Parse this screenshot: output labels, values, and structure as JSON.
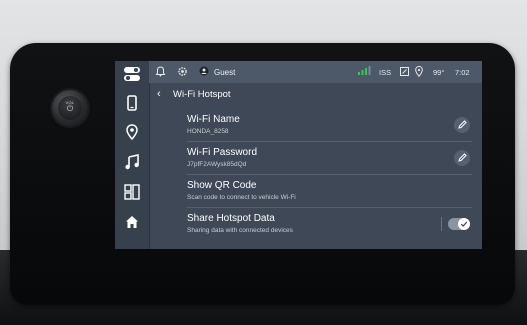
{
  "knob": {
    "label": "VOL",
    "icon": "power-icon"
  },
  "sidebar": {
    "items": [
      {
        "name": "toggles-icon"
      },
      {
        "name": "phone-icon"
      },
      {
        "name": "navigation-pin-icon"
      },
      {
        "name": "music-note-icon"
      },
      {
        "name": "apps-grid-icon"
      },
      {
        "name": "home-icon"
      }
    ]
  },
  "status": {
    "profile": "Guest",
    "network": "ISS",
    "temperature": "99°",
    "time": "7:02"
  },
  "header": {
    "back_label": "‹",
    "title": "Wi-Fi Hotspot"
  },
  "settings": [
    {
      "title": "Wi-Fi Name",
      "subtitle": "HONDA_8258",
      "control": "edit-icon"
    },
    {
      "title": "Wi-Fi Password",
      "subtitle": "J7pfF2AWysk85dQd",
      "control": "edit-icon"
    },
    {
      "title": "Show QR Code",
      "subtitle": "Scan code to connect to vehicle Wi-Fi",
      "control": "none"
    },
    {
      "title": "Share Hotspot Data",
      "subtitle": "Sharing data with connected devices",
      "control": "toggle",
      "enabled": true
    }
  ],
  "colors": {
    "screen_bg": "#3e4856",
    "statusbar_bg": "#4d5868",
    "sidebar_bg": "#37414e",
    "accent_signal": "#35c759"
  }
}
